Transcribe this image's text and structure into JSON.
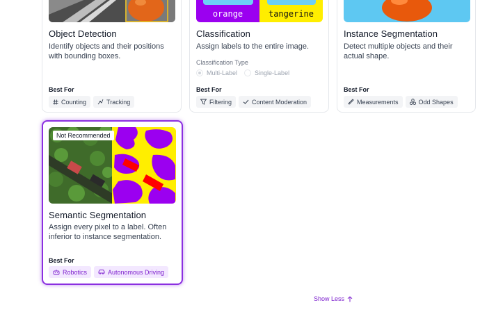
{
  "cards": [
    {
      "title": "Object Detection",
      "description": "Identify objects and their positions with bounding boxes.",
      "best_for_label": "Best For",
      "chips": [
        {
          "icon": "hash-icon",
          "label": "Counting"
        },
        {
          "icon": "tracking-icon",
          "label": "Tracking"
        }
      ]
    },
    {
      "title": "Classification",
      "description": "Assign labels to the entire image.",
      "image_labels": [
        "orange",
        "tangerine"
      ],
      "classification_type_label": "Classification Type",
      "options": [
        {
          "label": "Multi-Label",
          "checked": true
        },
        {
          "label": "Single-Label",
          "checked": false
        }
      ],
      "best_for_label": "Best For",
      "chips": [
        {
          "icon": "filter-icon",
          "label": "Filtering"
        },
        {
          "icon": "check-icon",
          "label": "Content Moderation"
        }
      ]
    },
    {
      "title": "Instance Segmentation",
      "description": "Detect multiple objects and their actual shape.",
      "best_for_label": "Best For",
      "chips": [
        {
          "icon": "ruler-icon",
          "label": "Measurements"
        },
        {
          "icon": "shapes-icon",
          "label": "Odd Shapes"
        }
      ]
    },
    {
      "title": "Semantic Segmentation",
      "badge": "Not Recommended",
      "description": "Assign every pixel to a label. Often inferior to instance segmentation.",
      "best_for_label": "Best For",
      "selected": true,
      "chips": [
        {
          "icon": "robot-icon",
          "label": "Robotics"
        },
        {
          "icon": "car-icon",
          "label": "Autonomous Driving"
        }
      ]
    }
  ],
  "show_less": "Show Less",
  "colors": {
    "accent": "#8b2fe0",
    "chip_purple_bg": "#f3e8ff",
    "seg_purple": "#9b00f0",
    "seg_yellow": "#ffee00",
    "seg_red": "#ff0000",
    "sky": "#5ec8f2"
  }
}
